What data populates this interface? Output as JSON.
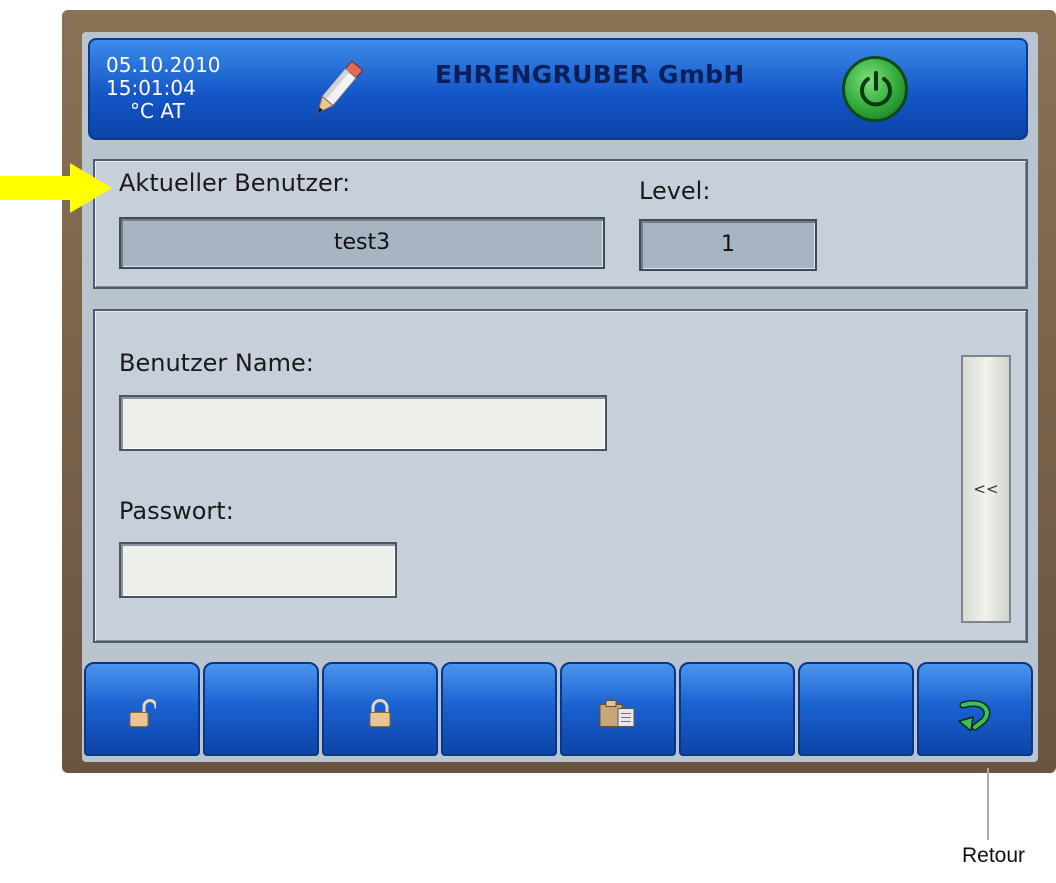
{
  "header": {
    "date": "05.10.2010",
    "time": "15:01:04",
    "units": "°C  AT",
    "company": "EHRENGRUBER GmbH",
    "pencil_icon": "pencil-icon",
    "power_icon": "power-icon"
  },
  "current_user": {
    "label": "Aktueller Benutzer:",
    "value": "test3",
    "level_label": "Level:",
    "level_value": "1"
  },
  "login": {
    "username_label": "Benutzer Name:",
    "username_value": "",
    "password_label": "Passwort:",
    "password_value": "",
    "side_button_label": "<<"
  },
  "toolbar": {
    "buttons": [
      {
        "icon": "unlock-icon"
      },
      {
        "icon": ""
      },
      {
        "icon": "lock-icon"
      },
      {
        "icon": ""
      },
      {
        "icon": "clipboard-icon"
      },
      {
        "icon": ""
      },
      {
        "icon": ""
      },
      {
        "icon": "return-arrow-icon"
      }
    ]
  },
  "annotation": {
    "retour_label": "Retour",
    "pointer_color": "#ffff00"
  },
  "colors": {
    "header_blue": "#1457c8",
    "panel_gray": "#c7d0da",
    "power_green": "#2fa83a",
    "bezel_brown": "#7a624a"
  }
}
